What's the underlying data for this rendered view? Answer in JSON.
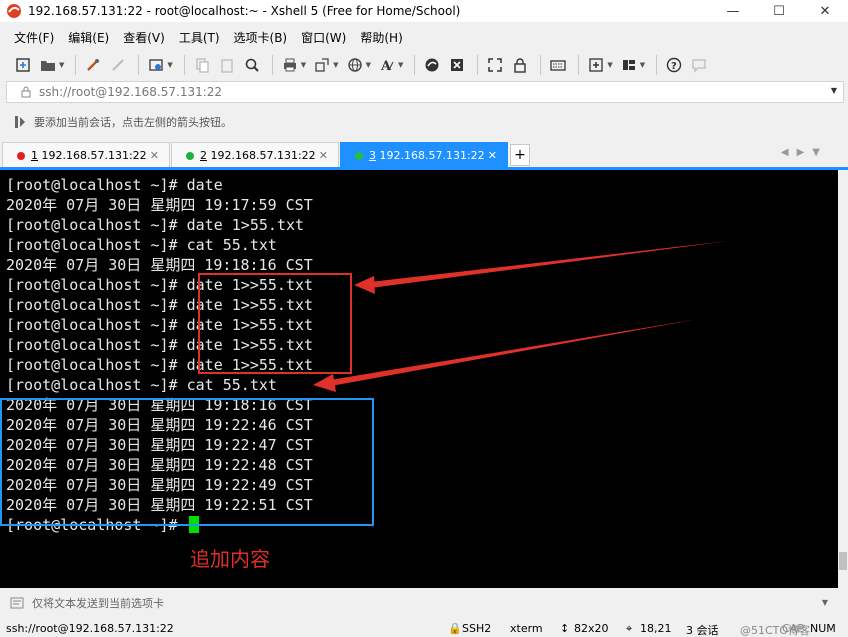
{
  "window": {
    "title": "192.168.57.131:22 - root@localhost:~ - Xshell 5 (Free for Home/School)",
    "minimize_glyph": "—",
    "maximize_glyph": "☐",
    "close_glyph": "✕"
  },
  "menu": {
    "items": [
      "文件(F)",
      "编辑(E)",
      "查看(V)",
      "工具(T)",
      "选项卡(B)",
      "窗口(W)",
      "帮助(H)"
    ]
  },
  "toolbar": {
    "icons": [
      "new-session-icon",
      "open-folder-icon",
      "properties-icon",
      "disconnect-icon",
      "settings-icon",
      "copy-icon",
      "paste-icon",
      "find-icon",
      "print-icon",
      "transfer-icon",
      "globe-icon",
      "font-icon",
      "xftp-icon",
      "xmanager-icon",
      "fullscreen-icon",
      "lock-icon",
      "keyboard-icon",
      "add-icon",
      "layout-icon",
      "help-icon",
      "chat-icon"
    ]
  },
  "address": {
    "value": "ssh://root@192.168.57.131:22"
  },
  "hint": {
    "text": "要添加当前会话，点击左侧的箭头按钮。"
  },
  "tabs": [
    {
      "number": "1",
      "label": "192.168.57.131:22",
      "dot_color": "#e02020",
      "active": false
    },
    {
      "number": "2",
      "label": "192.168.57.131:22",
      "dot_color": "#20b040",
      "active": false
    },
    {
      "number": "3",
      "label": "192.168.57.131:22",
      "dot_color": "#20c040",
      "active": true
    }
  ],
  "terminal": {
    "lines": [
      "[root@localhost ~]# date",
      "2020年 07月 30日 星期四 19:17:59 CST",
      "[root@localhost ~]# date 1>55.txt",
      "[root@localhost ~]# cat 55.txt",
      "2020年 07月 30日 星期四 19:18:16 CST",
      "[root@localhost ~]# date 1>>55.txt",
      "[root@localhost ~]# date 1>>55.txt",
      "[root@localhost ~]# date 1>>55.txt",
      "[root@localhost ~]# date 1>>55.txt",
      "[root@localhost ~]# date 1>>55.txt",
      "[root@localhost ~]# cat 55.txt",
      "2020年 07月 30日 星期四 19:18:16 CST",
      "2020年 07月 30日 星期四 19:22:46 CST",
      "2020年 07月 30日 星期四 19:22:47 CST",
      "2020年 07月 30日 星期四 19:22:48 CST",
      "2020年 07月 30日 星期四 19:22:49 CST",
      "2020年 07月 30日 星期四 19:22:51 CST",
      "[root@localhost ~]# "
    ],
    "annotation": "追加内容",
    "annotation_color": "#e0302a",
    "highlight_color": "#2196f3",
    "cursor_color": "#00e000"
  },
  "sendbar": {
    "text": "仅将文本发送到当前选项卡"
  },
  "status": {
    "connection": "ssh://root@192.168.57.131:22",
    "protocol": "SSH2",
    "terminal_type": "xterm",
    "size": "82x20",
    "position": "18,21",
    "sessions": "3 会话",
    "caps": "CAP",
    "num": "NUM",
    "watermark": "@51CTO博客"
  }
}
